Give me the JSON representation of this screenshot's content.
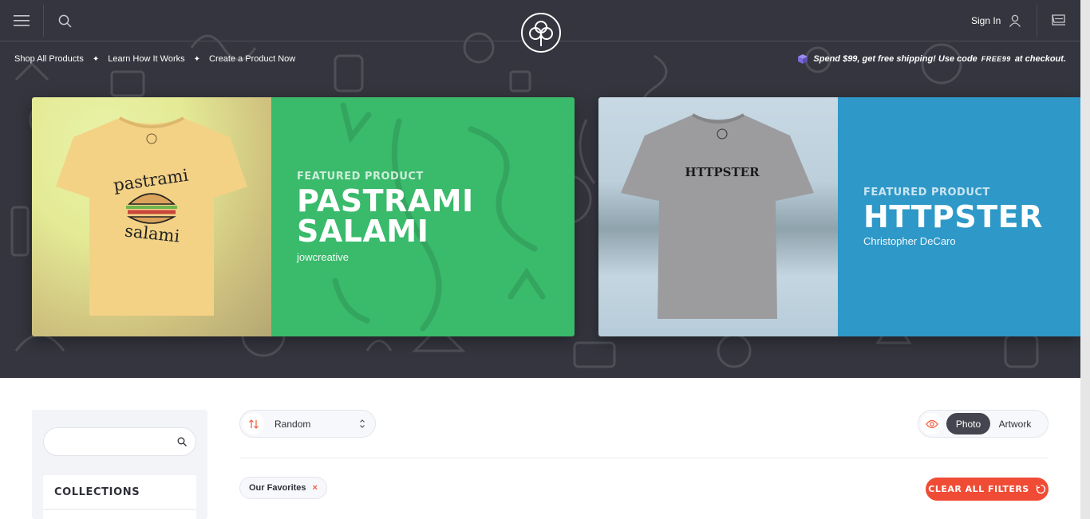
{
  "header": {
    "sign_in_label": "Sign In"
  },
  "subnav": {
    "links": [
      "Shop All Products",
      "Learn How It Works",
      "Create a Product Now"
    ],
    "separator": "✦"
  },
  "promo": {
    "prefix": "Spend $99, get free shipping! Use code",
    "code": "FREE99",
    "suffix": "at checkout."
  },
  "featured": [
    {
      "eyebrow": "FEATURED PRODUCT",
      "title_line1": "PASTRAMI",
      "title_line2": "SALAMI",
      "author": "jowcreative",
      "shirt_text_top": "pastrami",
      "shirt_text_bottom": "salami",
      "shirt_color": "#f3d286",
      "panel_color": "#3aba6b"
    },
    {
      "eyebrow": "FEATURED PRODUCT",
      "title_line1": "HTTPSTER",
      "title_line2": "",
      "author": "Christopher DeCaro",
      "shirt_text": "HTTPSTER",
      "shirt_color": "#9c9c9e",
      "panel_color": "#2e98c8"
    }
  ],
  "sidebar": {
    "search_placeholder": "",
    "collections_heading": "COLLECTIONS"
  },
  "sort": {
    "selected": "Random"
  },
  "view_toggle": {
    "options": [
      "Photo",
      "Artwork"
    ],
    "active": "Photo"
  },
  "filters": {
    "active_chips": [
      "Our Favorites"
    ],
    "remove_symbol": "×",
    "clear_all_label": "CLEAR ALL FILTERS"
  },
  "colors": {
    "header_bg": "#34353e",
    "accent": "#ef4b35",
    "green_panel": "#3aba6b",
    "blue_panel": "#2e98c8"
  }
}
